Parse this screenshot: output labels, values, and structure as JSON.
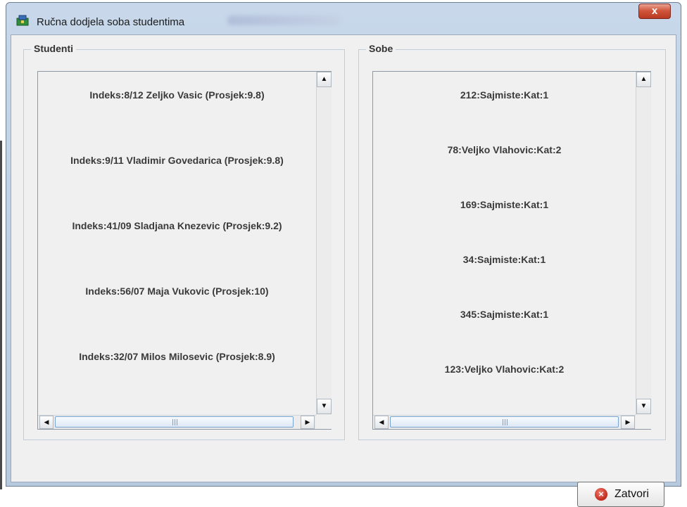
{
  "window": {
    "title": "Ručna dodjela soba studentima",
    "close_glyph": "x"
  },
  "students": {
    "title": "Studenti",
    "items": [
      "Indeks:8/12 Zeljko Vasic (Prosjek:9.8)",
      "Indeks:9/11 Vladimir Govedarica (Prosjek:9.8)",
      "Indeks:41/09 Sladjana Knezevic (Prosjek:9.2)",
      "Indeks:56/07 Maja Vukovic (Prosjek:10)",
      "Indeks:32/07 Milos Milosevic (Prosjek:8.9)"
    ]
  },
  "rooms": {
    "title": "Sobe",
    "items": [
      "212:Sajmiste:Kat:1",
      "78:Veljko Vlahovic:Kat:2",
      "169:Sajmiste:Kat:1",
      "34:Sajmiste:Kat:1",
      "345:Sajmiste:Kat:1",
      "123:Veljko Vlahovic:Kat:2"
    ]
  },
  "close_button": {
    "label": "Zatvori",
    "icon": "close-circle-icon"
  },
  "scroll_glyphs": {
    "up": "▲",
    "down": "▼",
    "left": "◀",
    "right": "▶"
  }
}
